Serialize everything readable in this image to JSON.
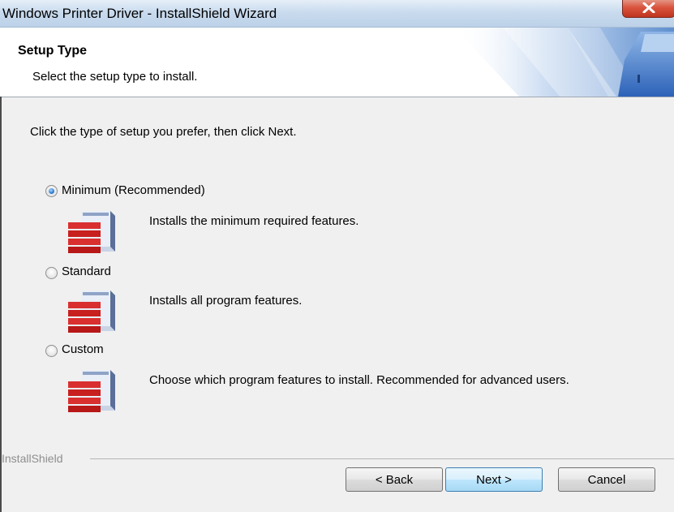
{
  "window": {
    "title": "Windows Printer Driver - InstallShield Wizard",
    "close_icon": "close-x-icon"
  },
  "header": {
    "title": "Setup Type",
    "subtitle": "Select the setup type to install.",
    "art_icon": "printer-banner-art"
  },
  "instruction": "Click the type of setup you prefer, then click Next.",
  "options": [
    {
      "label": "Minimum (Recommended)",
      "description": "Installs the minimum required features.",
      "selected": true,
      "icon": "setup-package-icon"
    },
    {
      "label": "Standard",
      "description": "Installs all program features.",
      "selected": false,
      "icon": "setup-package-icon"
    },
    {
      "label": "Custom",
      "description": "Choose which program features to install. Recommended for advanced users.",
      "selected": false,
      "icon": "setup-package-icon"
    }
  ],
  "footer": {
    "brand": "InstallShield",
    "back_label": "< Back",
    "next_label": "Next >",
    "cancel_label": "Cancel"
  },
  "colors": {
    "close_button": "#c0341e",
    "default_button_border": "#3c7fb1",
    "body_background": "#f0f0f0"
  }
}
